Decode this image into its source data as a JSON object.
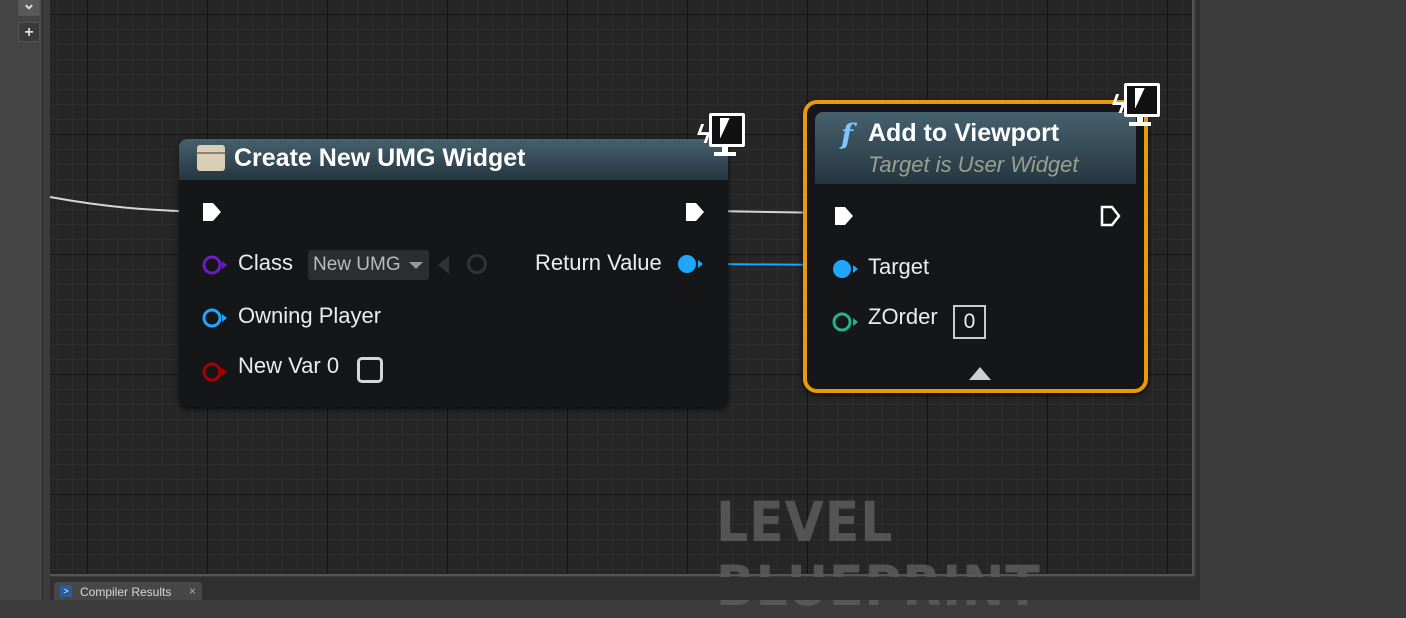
{
  "sidebar": {
    "add_button": "+",
    "collapse_button": "⌄"
  },
  "create_node": {
    "title": "Create New UMG Widget",
    "pins": {
      "class_label": "Class",
      "class_value": "New UMG",
      "owning_player_label": "Owning Player",
      "new_var_label": "New Var 0",
      "return_value_label": "Return Value"
    }
  },
  "add_node": {
    "title": "Add to Viewport",
    "subtitle": "Target is User Widget",
    "pins": {
      "target_label": "Target",
      "zorder_label": "ZOrder",
      "zorder_value": "0"
    }
  },
  "graph": {
    "watermark": "LEVEL BLUEPRINT"
  },
  "bottom_tabs": [
    {
      "label": "Compiler Results"
    }
  ],
  "colors": {
    "exec_pin": "#ffffff",
    "object_pin": "#1ea7ff",
    "class_pin": "#6a1fbf",
    "int_pin": "#1fb48c",
    "struct_pin": "#a80000",
    "selected_border": "#e89a0c",
    "header": "#3e5663",
    "wire_data": "#1ea7ff",
    "wire_exec": "#d6d6d6"
  },
  "icons": {
    "widget": "widget-blueprint-icon",
    "function": "function-icon",
    "client_only": "client-only-monitor-icon"
  }
}
